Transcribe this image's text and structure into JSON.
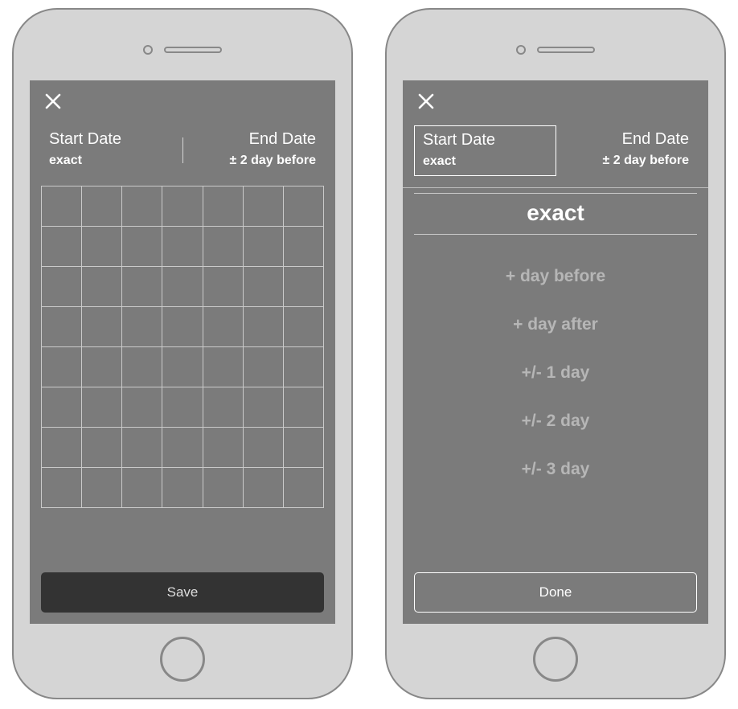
{
  "phone1": {
    "tabs": {
      "start": {
        "title": "Start Date",
        "value": "exact"
      },
      "end": {
        "title": "End Date",
        "value": "± 2 day before"
      }
    },
    "button_label": "Save"
  },
  "phone2": {
    "tabs": {
      "start": {
        "title": "Start Date",
        "value": "exact"
      },
      "end": {
        "title": "End Date",
        "value": "± 2 day before"
      }
    },
    "picker": {
      "selected": "exact",
      "options": [
        "+ day before",
        "+ day after",
        "+/- 1 day",
        "+/- 2 day",
        "+/- 3 day"
      ]
    },
    "button_label": "Done"
  }
}
